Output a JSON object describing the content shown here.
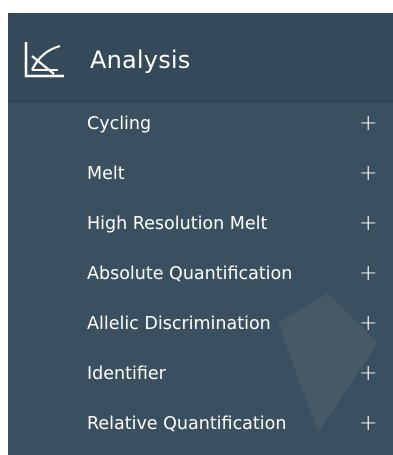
{
  "nav": {
    "header": {
      "title": "Analysis",
      "icon": "analysis-chart-icon"
    },
    "items": [
      {
        "label": "Cycling",
        "expand_icon": "+"
      },
      {
        "label": "Melt",
        "expand_icon": "+"
      },
      {
        "label": "High Resolution Melt",
        "expand_icon": "+"
      },
      {
        "label": "Absolute Quantification",
        "expand_icon": "+"
      },
      {
        "label": "Allelic Discrimination",
        "expand_icon": "+"
      },
      {
        "label": "Identifier",
        "expand_icon": "+"
      },
      {
        "label": "Relative Quantification",
        "expand_icon": "+"
      }
    ]
  },
  "colors": {
    "header_bg": "#34495a",
    "menu_bg": "#3a4f60",
    "text": "#ffffff"
  }
}
